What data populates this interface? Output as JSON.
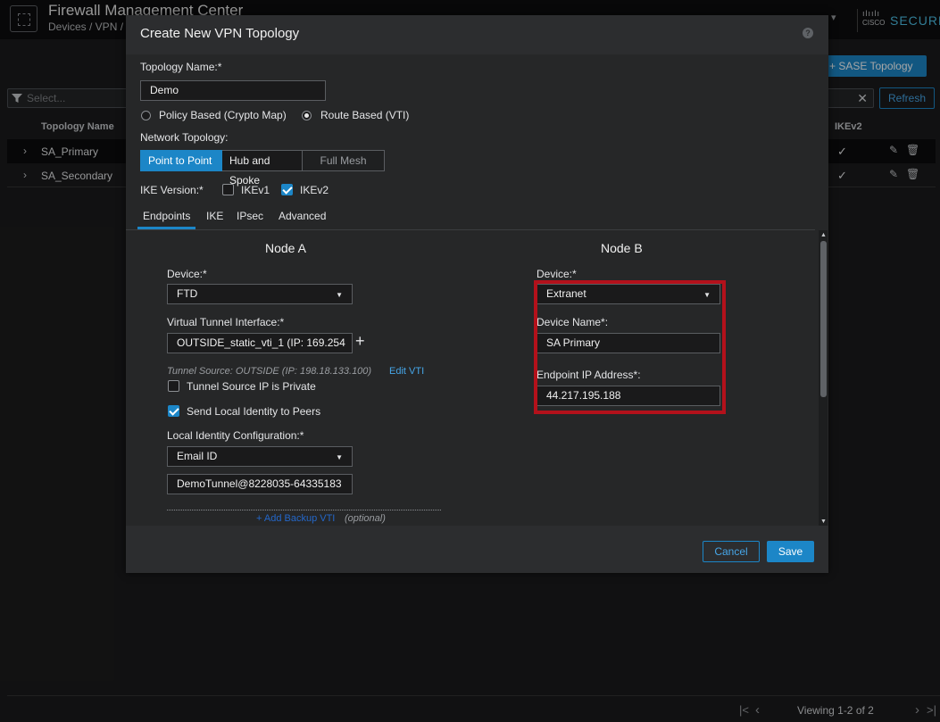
{
  "app": {
    "title": "Firewall Management Center",
    "breadcrumb": "Devices / VPN /",
    "brand_small": "CISCO",
    "brand_word": "SECURE"
  },
  "page": {
    "sase_button": "+ SASE Topology",
    "filter_placeholder": "Select...",
    "refresh_button": "Refresh",
    "columns": {
      "name": "Topology Name",
      "ikev2": "IKEv2"
    },
    "rows": [
      {
        "name": "SA_Primary",
        "ikev2": "✓"
      },
      {
        "name": "SA_Secondary",
        "ikev2": "✓"
      }
    ],
    "pager_text": "Viewing 1-2 of 2"
  },
  "modal": {
    "title": "Create New VPN Topology",
    "topology_name_label": "Topology Name:*",
    "topology_name_value": "Demo",
    "radio_policy": "Policy Based (Crypto Map)",
    "radio_route": "Route Based (VTI)",
    "network_topology_label": "Network Topology:",
    "seg_p2p": "Point to Point",
    "seg_hub": "Hub and Spoke",
    "seg_mesh": "Full Mesh",
    "ike_version_label": "IKE Version:*",
    "ikev1": "IKEv1",
    "ikev2": "IKEv2",
    "tabs": [
      "Endpoints",
      "IKE",
      "IPsec",
      "Advanced"
    ],
    "node_a": {
      "title": "Node A",
      "device_label": "Device:*",
      "device_value": "FTD",
      "vti_label": "Virtual Tunnel Interface:*",
      "vti_value": "OUTSIDE_static_vti_1 (IP: 169.254",
      "tunnel_source": "Tunnel Source: OUTSIDE (IP: 198.18.133.100)",
      "edit_vti": "Edit VTI",
      "private_label": "Tunnel Source IP is Private",
      "send_identity_label": "Send Local Identity to Peers",
      "identity_config_label": "Local Identity Configuration:*",
      "identity_type": "Email ID",
      "identity_value": "DemoTunnel@8228035-64335183",
      "add_backup": "+ Add Backup VTI",
      "optional": "(optional)"
    },
    "node_b": {
      "title": "Node B",
      "device_label": "Device:*",
      "device_value": "Extranet",
      "device_name_label": "Device Name*:",
      "device_name_value": "SA Primary",
      "endpoint_ip_label": "Endpoint IP Address*:",
      "endpoint_ip_value": "44.217.195.188"
    },
    "cancel": "Cancel",
    "save": "Save"
  },
  "colors": {
    "accent": "#1c86c7",
    "highlight": "#b3111b",
    "background": "#1b1b1c"
  }
}
